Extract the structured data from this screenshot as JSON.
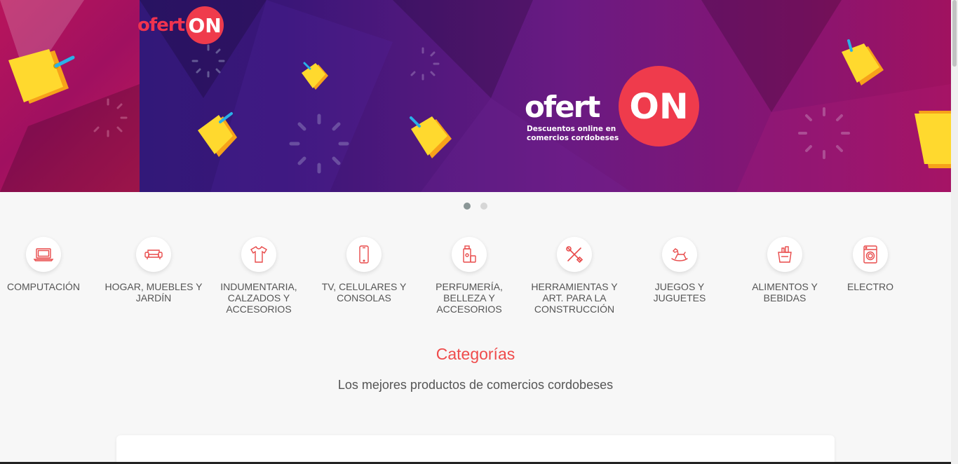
{
  "banner": {
    "logo_small": {
      "word": "ofert",
      "on": "ON"
    },
    "logo_big": {
      "word": "ofert",
      "on": "ON",
      "tagline_1": "Descuentos online en",
      "tagline_2": "comercios cordobeses"
    },
    "slide_count": 2,
    "active_slide": 1
  },
  "categories": [
    {
      "label": "COMPUTACIÓN",
      "icon": "laptop-icon"
    },
    {
      "label": "HOGAR, MUEBLES Y JARDÍN",
      "icon": "sofa-icon"
    },
    {
      "label": "INDUMENTARIA, CALZADOS Y ACCESORIOS",
      "icon": "tshirt-icon"
    },
    {
      "label": "TV, CELULARES Y CONSOLAS",
      "icon": "smartphone-icon"
    },
    {
      "label": "PERFUMERÍA, BELLEZA Y ACCESORIOS",
      "icon": "perfume-icon"
    },
    {
      "label": "HERRAMIENTAS Y ART. PARA LA CONSTRUCCIÓN",
      "icon": "tools-icon"
    },
    {
      "label": "JUEGOS Y JUGUETES",
      "icon": "rocking-horse-icon"
    },
    {
      "label": "ALIMENTOS Y BEBIDAS",
      "icon": "groceries-icon"
    },
    {
      "label": "ELECTRO",
      "icon": "washing-machine-icon"
    }
  ],
  "section": {
    "title": "Categorías",
    "subtitle": "Los mejores productos de comercios cordobeses"
  },
  "colors": {
    "accent": "#ef4b4b",
    "brand_red": "#ef3b4c",
    "tag_yellow": "#ffd92e"
  }
}
